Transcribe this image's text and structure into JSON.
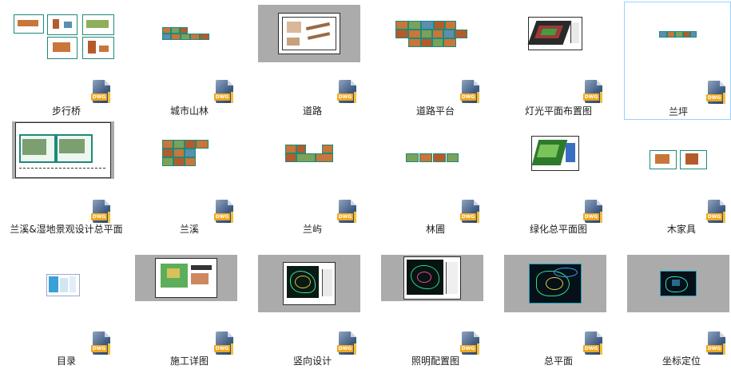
{
  "icon_type_label": "DWG",
  "files": [
    {
      "name": "步行桥",
      "thumb": "multi-sheet"
    },
    {
      "name": "城市山林",
      "thumb": "strip"
    },
    {
      "name": "道路",
      "thumb": "framed-sheet"
    },
    {
      "name": "道路平台",
      "thumb": "multi-sheet"
    },
    {
      "name": "灯光平面布置图",
      "thumb": "plan"
    },
    {
      "name": "兰坪",
      "thumb": "strip-small",
      "selected": true
    },
    {
      "name": "兰溪&湿地景观设计总平面",
      "thumb": "framed-sheet"
    },
    {
      "name": "兰溪",
      "thumb": "multi-sheet"
    },
    {
      "name": "兰屿",
      "thumb": "multi-sheet"
    },
    {
      "name": "林圃",
      "thumb": "strip"
    },
    {
      "name": "绿化总平面图",
      "thumb": "plan"
    },
    {
      "name": "木家具",
      "thumb": "two-sheet"
    },
    {
      "name": "目录",
      "thumb": "index"
    },
    {
      "name": "施工详图",
      "thumb": "framed-sheet"
    },
    {
      "name": "竖向设计",
      "thumb": "dark-sheet"
    },
    {
      "name": "照明配置图",
      "thumb": "dark-sheet"
    },
    {
      "name": "总平面",
      "thumb": "dark-sheet"
    },
    {
      "name": "坐标定位",
      "thumb": "dark-sheet"
    }
  ]
}
